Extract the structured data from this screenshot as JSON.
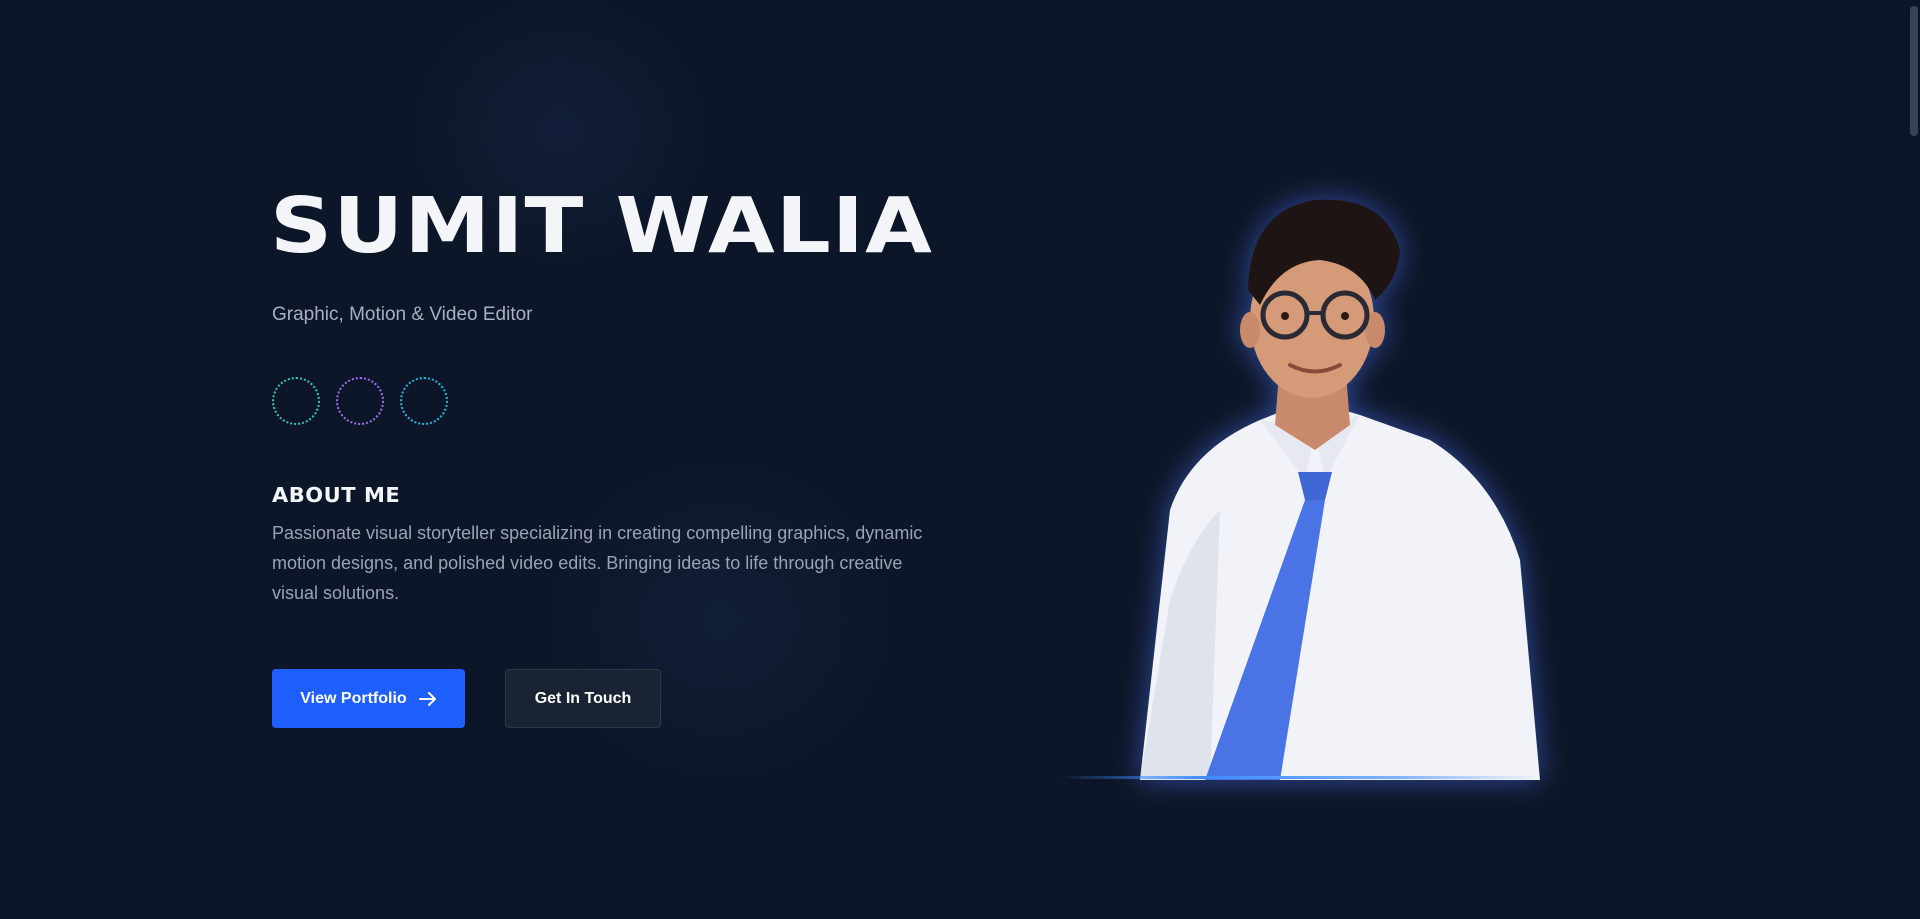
{
  "hero": {
    "name": "SUMIT WALIA",
    "subtitle": "Graphic, Motion & Video Editor"
  },
  "social": {
    "icons": [
      "social-icon-1",
      "social-icon-2",
      "social-icon-3"
    ],
    "colors": [
      "#2ec4b6",
      "#a06cf0",
      "#22b8d8"
    ]
  },
  "about": {
    "heading": "ABOUT ME",
    "text": "Passionate visual storyteller specializing in creating compelling graphics, dynamic motion designs, and polished video edits. Bringing ideas to life through creative visual solutions."
  },
  "buttons": {
    "portfolio_label": "View Portfolio",
    "portfolio_icon": "arrow-right-icon",
    "contact_label": "Get In Touch"
  },
  "colors": {
    "background": "#0d1628",
    "accent": "#1f5eff",
    "text_primary": "#f3f5f8",
    "text_muted": "#9aa3b2"
  }
}
